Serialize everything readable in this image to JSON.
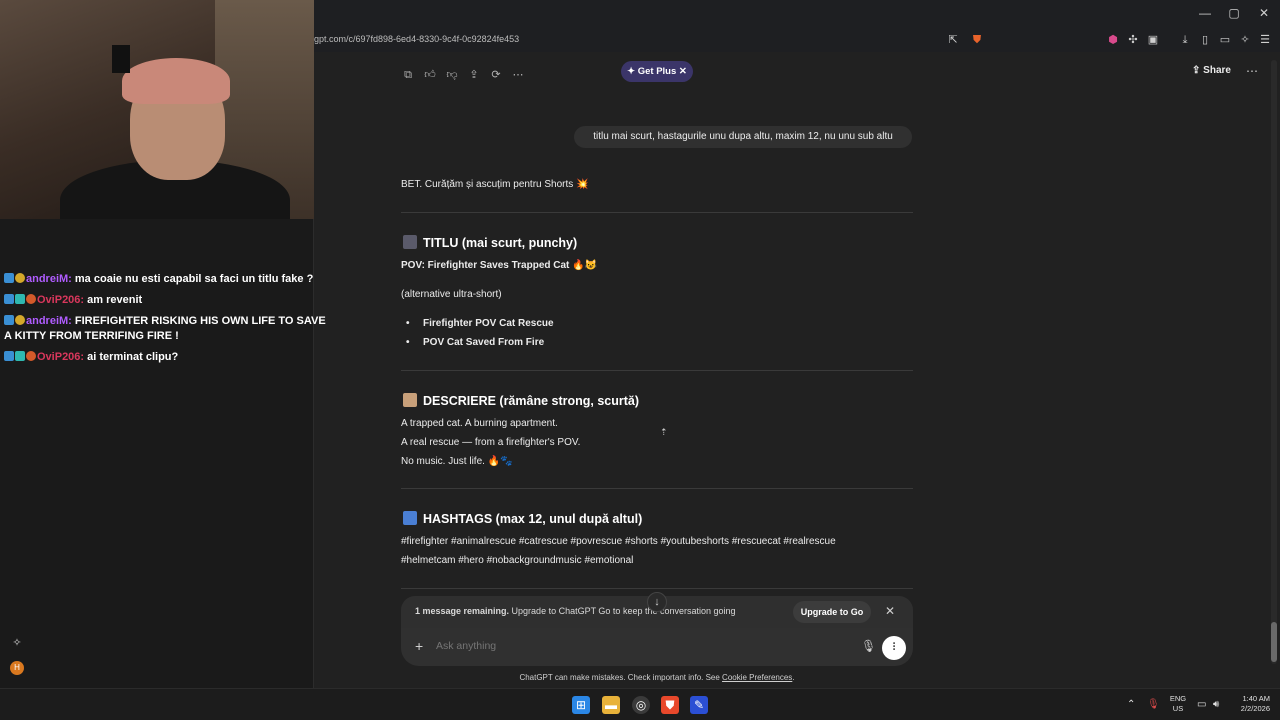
{
  "browser": {
    "url": "gpt.com/c/697fd898-6ed4-8330-9c4f-0c92824fe453",
    "window_controls": [
      "—",
      "▢",
      "✕"
    ]
  },
  "stream_chat": [
    {
      "user": "andreiM:",
      "message": "ma coaie nu esti capabil sa faci un titlu fake ?",
      "user_color": "#b05cff"
    },
    {
      "user": "OviP206:",
      "message": "am revenit",
      "user_color": "#d9375c"
    },
    {
      "user": "andreiM:",
      "message": "FIREFIGHTER RISKING HIS OWN LIFE TO SAVE A KITTY FROM TERRIFING FIRE !",
      "user_color": "#b05cff"
    },
    {
      "user": "OviP206:",
      "message": "ai terminat clipu?",
      "user_color": "#d9375c"
    }
  ],
  "chatgpt": {
    "get_plus_label": "Get Plus",
    "share_label": "Share",
    "user_message": "titlu mai scurt, hastagurile unu dupa altu, maxim 12, nu unu sub altu",
    "intro": "BET. Curățăm și ascuțim pentru Shorts 💥",
    "section_title": {
      "heading": "TITLU (mai scurt, punchy)",
      "main": "POV: Firefighter Saves Trapped Cat 🔥😺",
      "alt_label": "(alternative ultra-short)",
      "alts": [
        "Firefighter POV Cat Rescue",
        "POV Cat Saved From Fire"
      ]
    },
    "section_desc": {
      "heading": "DESCRIERE (rămâne strong, scurtă)",
      "lines": [
        "A trapped cat. A burning apartment.",
        "A real rescue — from a firefighter's POV.",
        "No music. Just life. 🔥🐾"
      ]
    },
    "section_tags": {
      "heading": "HASHTAGS (max 12, unul după altul)",
      "line1": "#firefighter #animalrescue #catrescue #povrescue #shorts #youtubeshorts #rescuecat #realrescue",
      "line2": "#helmetcam #hero #nobackgroundmusic #emotional"
    },
    "notice": {
      "bold": "1 message remaining.",
      "text": " Upgrade to ChatGPT Go to keep the conversation going",
      "button": "Upgrade to Go"
    },
    "composer_placeholder": "Ask anything",
    "disclaimer_text": "ChatGPT can make mistakes. Check important info. See ",
    "disclaimer_link": "Cookie Preferences",
    "disclaimer_end": "."
  },
  "taskbar": {
    "lang_top": "ENG",
    "lang_bottom": "US",
    "time": "1:40 AM",
    "date": "2/2/2026"
  },
  "colors": {
    "accent_get_plus": "#3b3569",
    "background": "#212121"
  }
}
